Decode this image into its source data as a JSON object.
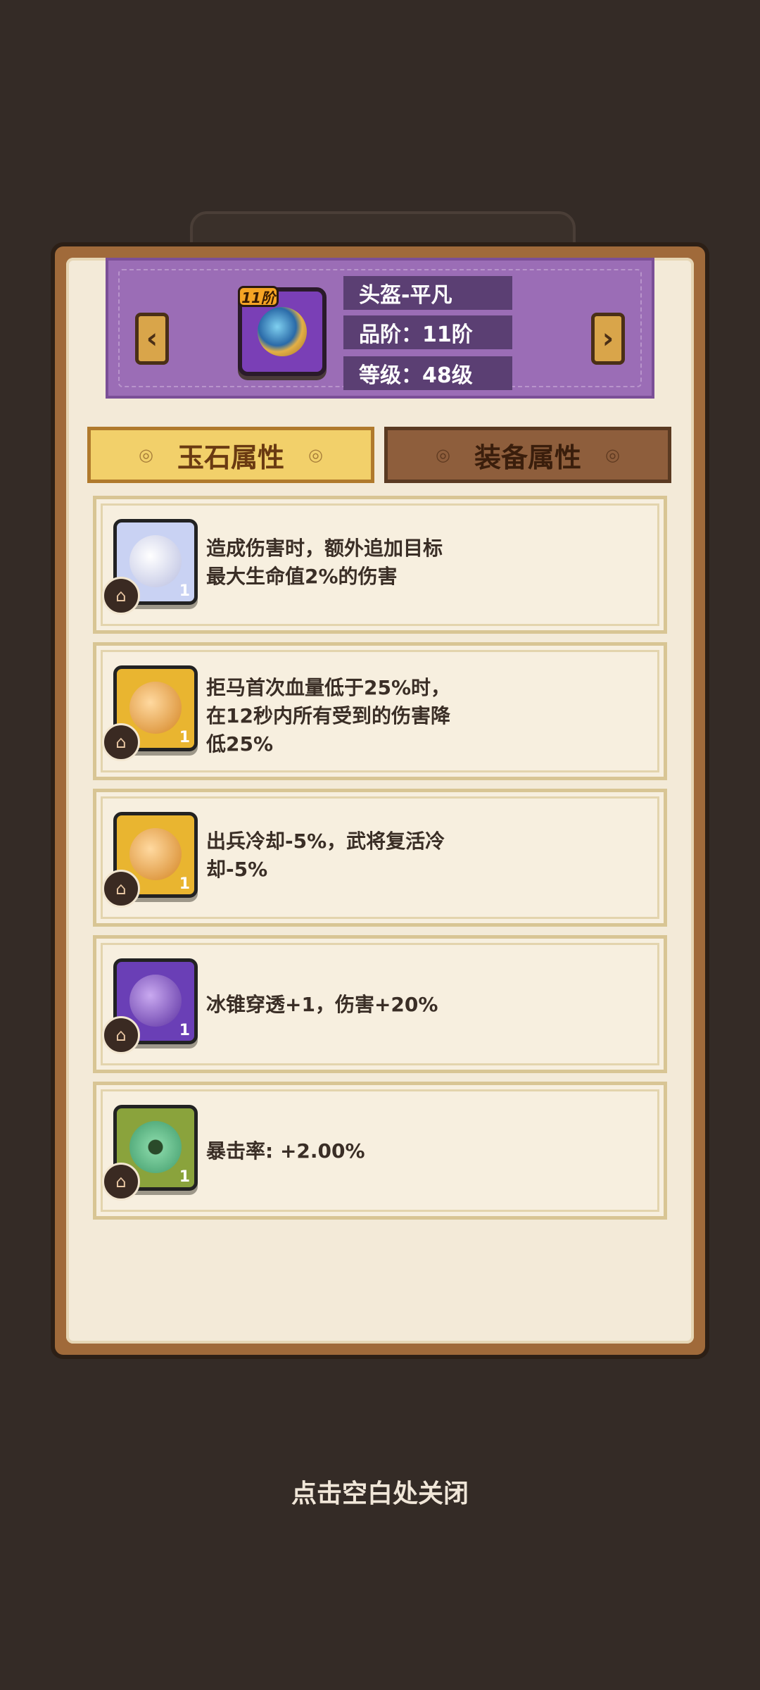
{
  "item": {
    "name": "头盔-平凡",
    "grade_label": "品阶：11阶",
    "level_label": "等级：48级",
    "badge": "11阶",
    "icon": "helmet-icon"
  },
  "nav": {
    "prev_icon": "chevron-left-icon",
    "next_icon": "chevron-right-icon",
    "prev_glyph": "‹",
    "next_glyph": "›"
  },
  "tabs": [
    {
      "label": "玉石属性",
      "active": true
    },
    {
      "label": "装备属性",
      "active": false
    }
  ],
  "gems": [
    {
      "text": "造成伤害时，额外追加目标\n最大生命值2%的伤害",
      "count": "1",
      "color": "#c9d2f3",
      "icon": "dragon-jade-icon"
    },
    {
      "text": "拒马首次血量低于25%时，\n在12秒内所有受到的伤害降\n低25%",
      "count": "1",
      "color": "#e9b530",
      "icon": "amber-swirl-icon"
    },
    {
      "text": "出兵冷却-5%，武将复活冷\n却-5%",
      "count": "1",
      "color": "#e9b530",
      "icon": "amber-swirl-icon"
    },
    {
      "text": "冰锥穿透+1，伤害+20%",
      "count": "1",
      "color": "#6a3fb6",
      "icon": "purple-jade-icon"
    },
    {
      "text": "暴击率: +2.00%",
      "count": "1",
      "color": "#8aa33c",
      "icon": "jade-disc-icon"
    }
  ],
  "footer": {
    "close_hint": "点击空白处关闭"
  }
}
